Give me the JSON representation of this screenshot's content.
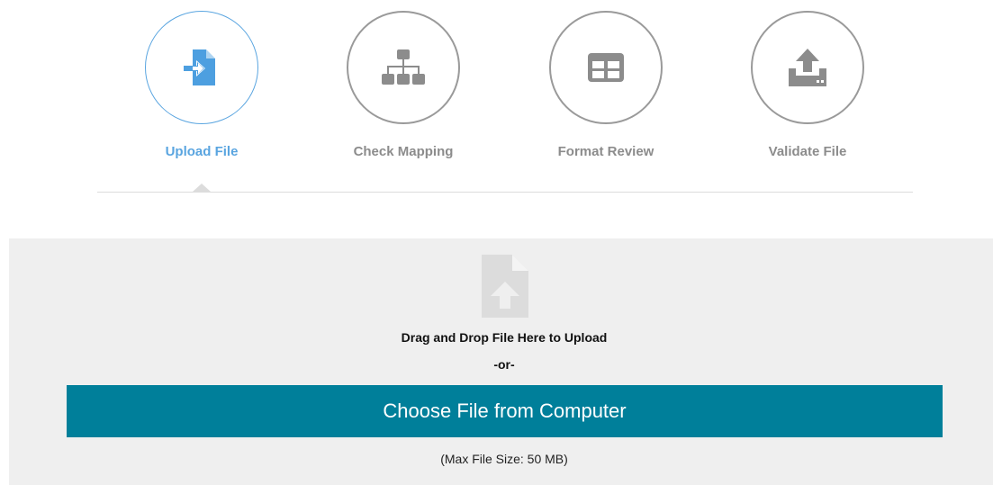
{
  "steps": [
    {
      "label": "Upload File",
      "icon": "file-import-icon",
      "active": true
    },
    {
      "label": "Check Mapping",
      "icon": "sitemap-icon",
      "active": false
    },
    {
      "label": "Format Review",
      "icon": "table-icon",
      "active": false
    },
    {
      "label": "Validate File",
      "icon": "upload-tray-icon",
      "active": false
    }
  ],
  "dropzone": {
    "icon": "file-upload-icon",
    "drag_text": "Drag and Drop File Here to Upload",
    "or_text": "-or-",
    "choose_label": "Choose File from Computer",
    "max_size": "(Max File Size: 50 MB)"
  },
  "colors": {
    "active": "#5aa5e0",
    "inactive": "#8c8c8c",
    "button": "#007f9a",
    "dropzone_bg": "#efefef"
  }
}
